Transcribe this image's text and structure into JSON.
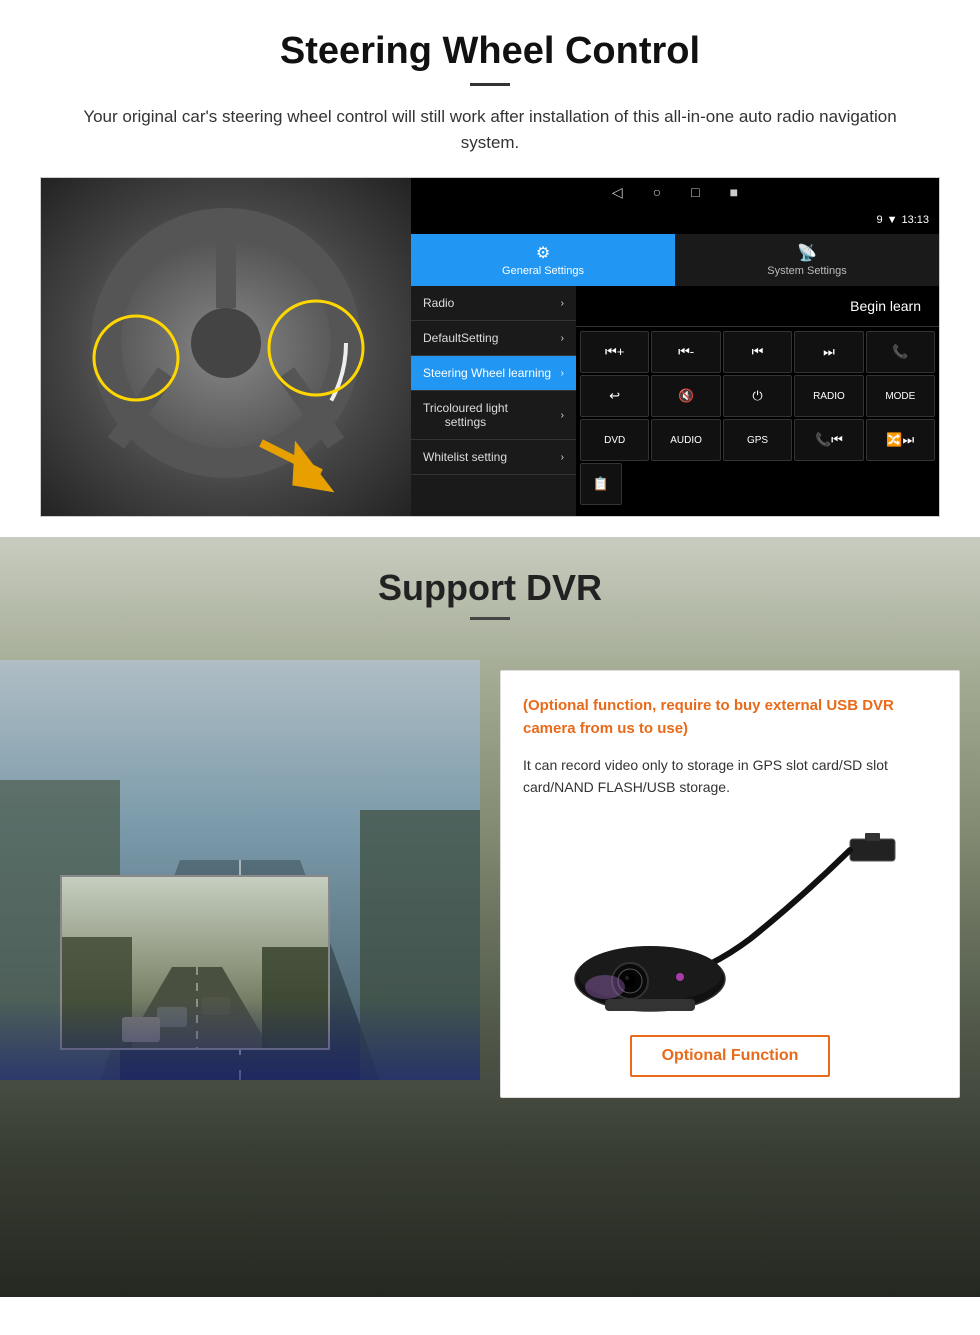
{
  "steering_section": {
    "title": "Steering Wheel Control",
    "description": "Your original car's steering wheel control will still work after installation of this all-in-one auto radio navigation system.",
    "android_ui": {
      "statusbar": {
        "time": "13:13",
        "icons": [
          "♥",
          "▼",
          "9"
        ]
      },
      "tabs": [
        {
          "label": "General Settings",
          "active": true,
          "icon": "⚙"
        },
        {
          "label": "System Settings",
          "active": false,
          "icon": "📡"
        }
      ],
      "navbar_icons": [
        "◁",
        "○",
        "□",
        "■"
      ],
      "menu_items": [
        {
          "label": "Radio",
          "active": false
        },
        {
          "label": "DefaultSetting",
          "active": false
        },
        {
          "label": "Steering Wheel learning",
          "active": true
        },
        {
          "label": "Tricoloured light settings",
          "active": false
        },
        {
          "label": "Whitelist setting",
          "active": false
        }
      ],
      "begin_learn": "Begin learn",
      "control_buttons_row1": [
        "⏮+",
        "⏮-",
        "⏮",
        "⏭",
        "📞"
      ],
      "control_buttons_row2": [
        "↩",
        "🔇",
        "⏻",
        "RADIO",
        "MODE"
      ],
      "control_buttons_row3": [
        "DVD",
        "AUDIO",
        "GPS",
        "📞⏮",
        "🔀⏭"
      ],
      "control_buttons_row4": [
        "📋"
      ]
    }
  },
  "dvr_section": {
    "title": "Support DVR",
    "optional_note": "(Optional function, require to buy external USB DVR camera from us to use)",
    "description": "It can record video only to storage in GPS slot card/SD slot card/NAND FLASH/USB storage.",
    "optional_function_label": "Optional Function"
  }
}
